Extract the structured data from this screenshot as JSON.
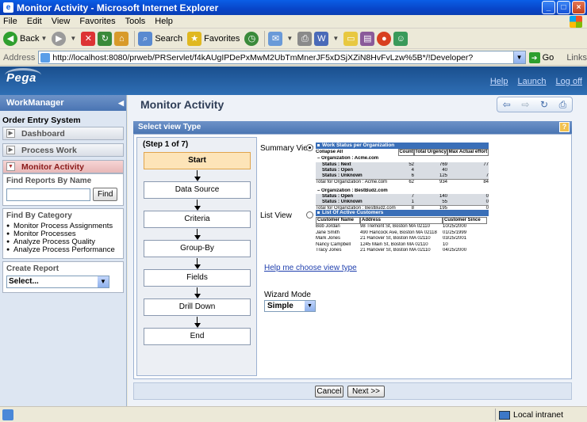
{
  "window": {
    "title": "Monitor Activity - Microsoft Internet Explorer"
  },
  "menu": [
    "File",
    "Edit",
    "View",
    "Favorites",
    "Tools",
    "Help"
  ],
  "toolbar": {
    "back": "Back",
    "search": "Search",
    "favorites": "Favorites"
  },
  "address": {
    "label": "Address",
    "url": "http://localhost:8080/prweb/PRServlet/f4kAUgIPDePxMwM2UbTmMnerJF5xDSjXZiN8HvFvLzw%5B*/!Developer?",
    "go": "Go",
    "links": "Links"
  },
  "header": {
    "logo": "Pega",
    "links": [
      "Help",
      "Launch",
      "Log off"
    ]
  },
  "left": {
    "title": "WorkManager",
    "section": "Order Entry System",
    "nav": [
      {
        "label": "Dashboard",
        "active": false
      },
      {
        "label": "Process Work",
        "active": false
      },
      {
        "label": "Monitor Activity",
        "active": true
      }
    ],
    "find_title": "Find Reports By Name",
    "find_button": "Find",
    "category_title": "Find By Category",
    "categories": [
      "Monitor Process Assignments",
      "Monitor Processes",
      "Analyze Process Quality",
      "Analyze Process Performance"
    ],
    "create_title": "Create Report",
    "create_select": "Select..."
  },
  "main": {
    "title": "Monitor Activity",
    "panel_title": "Select view Type",
    "help_glyph": "?",
    "step_label": "(Step 1 of 7)",
    "steps": [
      "Start",
      "Data Source",
      "Criteria",
      "Group-By",
      "Fields",
      "Drill Down",
      "End"
    ],
    "summary_label": "Summary View",
    "list_label": "List View",
    "help_link": "Help me choose view type",
    "wizard_label": "Wizard Mode",
    "wizard_value": "Simple",
    "cancel": "Cancel",
    "next": "Next >>"
  },
  "summary_preview": {
    "title": "Work Status per Organization",
    "collapse": "Collapse All",
    "columns": [
      "Count",
      "Total Urgency",
      "Max Actual effort"
    ],
    "org1": "Organization : Acme.com",
    "org1_rows": [
      {
        "label": "Status : Next",
        "count": "52",
        "urgency": "769",
        "effort": "77"
      },
      {
        "label": "Status : Open",
        "count": "4",
        "urgency": "40",
        "effort": ""
      },
      {
        "label": "Status : Unknown",
        "count": "6",
        "urgency": "125",
        "effort": "7"
      }
    ],
    "org1_total": {
      "label": "Total for Organization : Acme.com",
      "count": "62",
      "urgency": "934",
      "effort": "84"
    },
    "org2": "Organization : BestBudz.com",
    "org2_rows": [
      {
        "label": "Status : Open",
        "count": "7",
        "urgency": "140",
        "effort": "0"
      },
      {
        "label": "Status : Unknown",
        "count": "1",
        "urgency": "55",
        "effort": "0"
      }
    ],
    "org2_total": {
      "label": "Total for Organization : BestBudz.com",
      "count": "8",
      "urgency": "195",
      "effort": "0"
    }
  },
  "list_preview": {
    "title": "List Of Active Customers",
    "columns": [
      "Customer Name",
      "Address",
      "Customer Since"
    ],
    "rows": [
      [
        "Bob Jordan",
        "98 Tremont St, Boston MA 02110",
        "10/25/2000"
      ],
      [
        "Jane Smith",
        "490 Hancock Ave, Boston MA 02118",
        "01/25/1999"
      ],
      [
        "Mark Jones",
        "21 Hanover St, Boston MA 02110",
        "03/25/2001"
      ],
      [
        "Nancy Campbell",
        "1245 Main St, Boston MA 02110",
        "10"
      ],
      [
        "Tracy Jones",
        "21 Hanover St, Boston MA 02110",
        "04/25/2000"
      ]
    ]
  },
  "status": {
    "zone": "Local intranet"
  }
}
